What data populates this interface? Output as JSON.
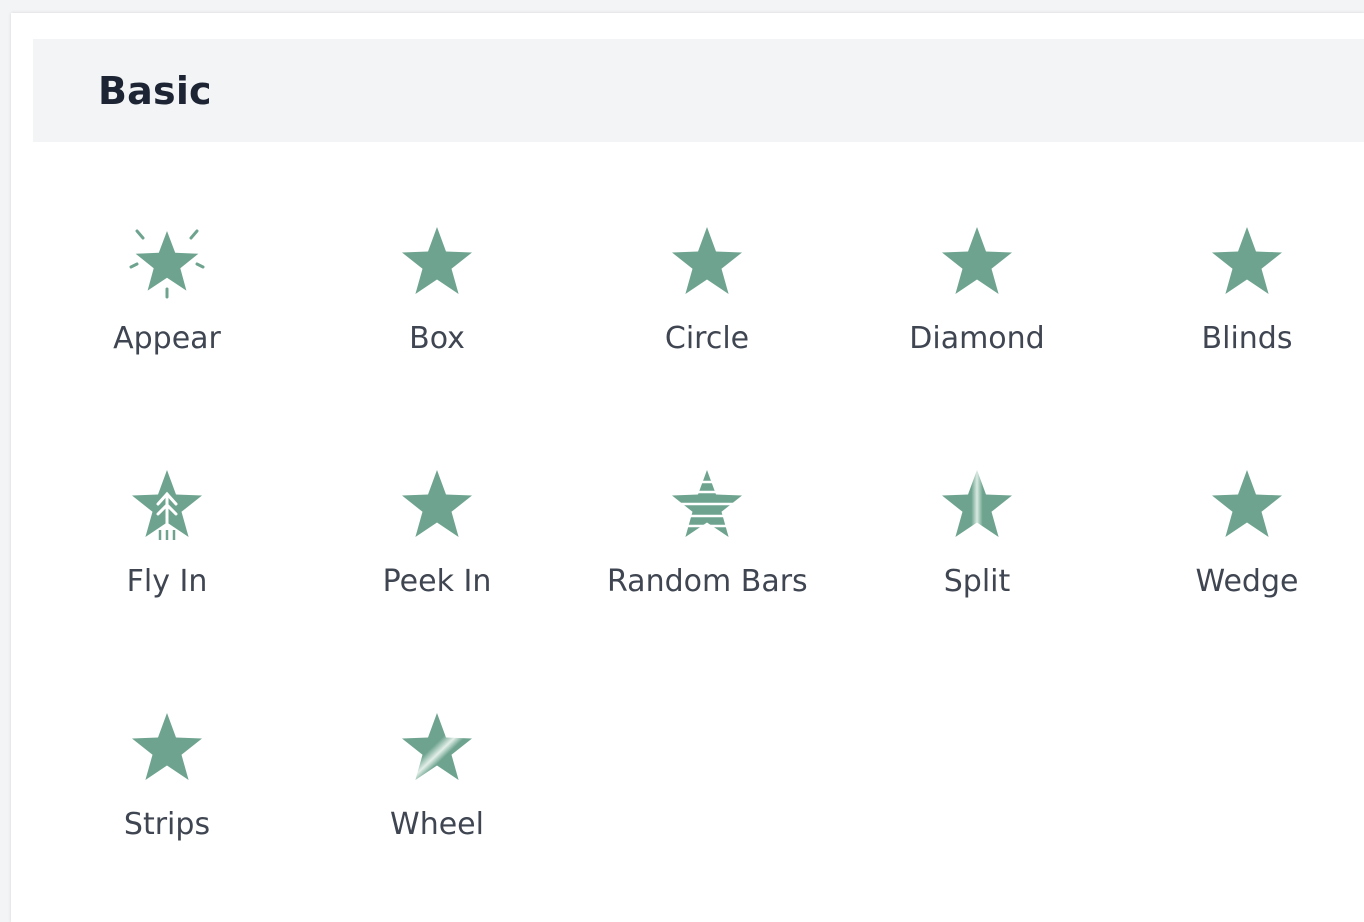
{
  "section": {
    "title": "Basic"
  },
  "accent_color": "#6ea48f",
  "effects": [
    {
      "label": "Appear",
      "icon": "star-burst-icon"
    },
    {
      "label": "Box",
      "icon": "star-icon"
    },
    {
      "label": "Circle",
      "icon": "star-icon"
    },
    {
      "label": "Diamond",
      "icon": "star-icon"
    },
    {
      "label": "Blinds",
      "icon": "star-icon"
    },
    {
      "label": "Fly In",
      "icon": "star-fly-in-icon"
    },
    {
      "label": "Peek In",
      "icon": "star-icon"
    },
    {
      "label": "Random Bars",
      "icon": "star-bars-icon"
    },
    {
      "label": "Split",
      "icon": "star-split-icon"
    },
    {
      "label": "Wedge",
      "icon": "star-icon"
    },
    {
      "label": "Strips",
      "icon": "star-icon"
    },
    {
      "label": "Wheel",
      "icon": "star-wheel-icon"
    }
  ]
}
